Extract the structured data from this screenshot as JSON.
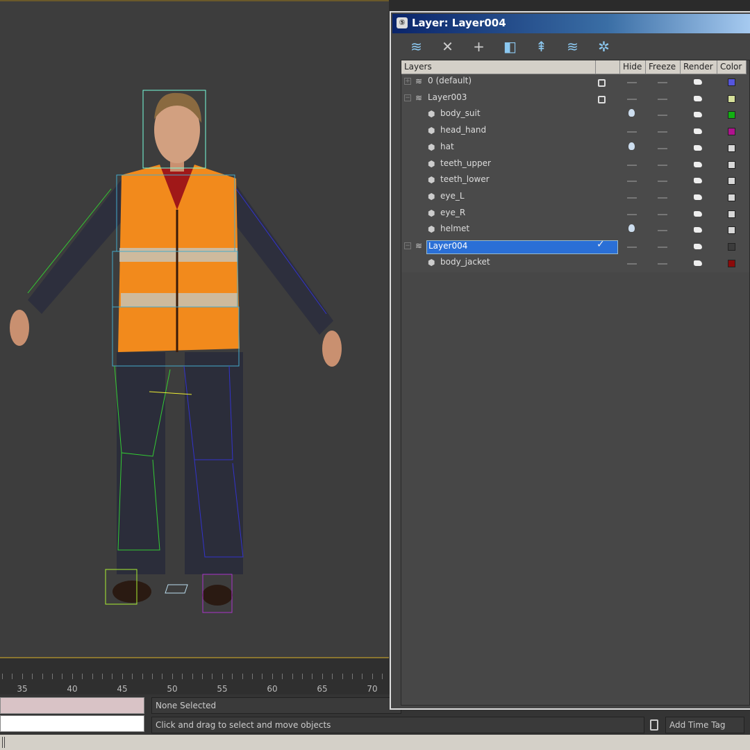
{
  "panel": {
    "title": "Layer: Layer004",
    "toolbar": [
      {
        "icon": "create-layer-icon",
        "glyph": "≋"
      },
      {
        "icon": "delete-icon",
        "glyph": "✕"
      },
      {
        "icon": "add-icon",
        "glyph": "+"
      },
      {
        "icon": "select-objects-icon",
        "glyph": "◧"
      },
      {
        "icon": "highlight-selected-icon",
        "glyph": "⇞"
      },
      {
        "icon": "hide-all-icon",
        "glyph": "≋"
      },
      {
        "icon": "freeze-all-icon",
        "glyph": "✲"
      }
    ],
    "columns": {
      "layers": "Layers",
      "current": "",
      "hide": "Hide",
      "freeze": "Freeze",
      "render": "Render",
      "color": "Color"
    },
    "rows": [
      {
        "name": "0 (default)",
        "type": "layer",
        "expander": "+",
        "current": "box",
        "hide": "dash",
        "color": "#5555dd"
      },
      {
        "name": "Layer003",
        "type": "layer",
        "expander": "−",
        "current": "box",
        "hide": "dash",
        "color": "#d6e09a"
      },
      {
        "name": "body_suit",
        "type": "object",
        "hide": "bulb",
        "color": "#12b012"
      },
      {
        "name": "head_hand",
        "type": "object",
        "hide": "dash",
        "color": "#b0128e"
      },
      {
        "name": "hat",
        "type": "object",
        "hide": "bulb",
        "color": "#d8d8d8"
      },
      {
        "name": "teeth_upper",
        "type": "object",
        "hide": "dash",
        "color": "#d8d8d8"
      },
      {
        "name": "teeth_lower",
        "type": "object",
        "hide": "dash",
        "color": "#d8d8d8"
      },
      {
        "name": "eye_L",
        "type": "object",
        "hide": "dash",
        "color": "#d8d8d8"
      },
      {
        "name": "eye_R",
        "type": "object",
        "hide": "dash",
        "color": "#d8d8d8"
      },
      {
        "name": "helmet",
        "type": "object",
        "hide": "bulb",
        "color": "#d8d8d8"
      },
      {
        "name": "Layer004",
        "type": "layer",
        "expander": "−",
        "current": "check",
        "selected": true,
        "hide": "dash",
        "color": "#3c3c3c"
      },
      {
        "name": "body_jacket",
        "type": "object",
        "hide": "dash",
        "color": "#8b0a0a"
      }
    ]
  },
  "timeline": {
    "labels": [
      "35",
      "40",
      "45",
      "50",
      "55",
      "60",
      "65",
      "70"
    ]
  },
  "status": {
    "selection": "None Selected",
    "prompt": "Click and drag to select and move objects",
    "add_time_tag": "Add Time Tag"
  }
}
